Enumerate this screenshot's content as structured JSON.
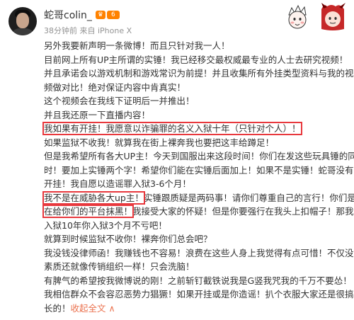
{
  "author": {
    "name": "蛇哥colin_",
    "level_badge": "6"
  },
  "meta": {
    "time": "38分钟前",
    "source": "来自 iPhone X"
  },
  "lines": [
    [
      "另外我要新声明一条微博！而且只针对我一人！"
    ],
    [
      "目前网上所有UP主所谓的实锤！我已经移交最权威最专业的人士去研究视频！"
    ],
    [
      "并且承诺会以游戏机制和游戏常识为前提！并且收集所有外挂类型资料与我的视"
    ],
    [
      "频做对比！绝对保证内容中肯真实！"
    ],
    [
      "这个视频会在我线下证明后一并推出！"
    ],
    [
      "并且我还原一下直播内容！"
    ],
    [
      "我如果有开挂！我愿意以诈骗罪的名义入狱十年（只针对个人）！"
    ],
    [
      "如果监狱不收我！就算我在街上裸奔我也要把这丰给蹲足！"
    ],
    [
      "但是我希望所有各大UP主！今天到国服出来这段时间！你们在发这些玩具锤的同"
    ],
    [
      "时！要加上实锤两个字！希望你们能在实锤后面加上！如果不是实锤！蛇哥没有"
    ],
    [
      "开挂！我自愿以造谣罪入狱3-6个月！"
    ],
    [
      "我不是在威胁各大up主！",
      "实锤跟质疑是两码事！请你们尊重自己的言行！你们是"
    ],
    [
      "在给你们的平台抹黑！",
      "我接受大家的怀疑！但是你要强行在我头上扣帽子！那我"
    ],
    [
      "入狱10年你入狱3个月不亏吧！"
    ],
    [
      "就算到时候监狱不收你！裸奔你们总会吧？"
    ],
    [
      "我没钱没律师函！我赚钱也不容易！浪费在这些人身上我觉得有点可惜！不仅没"
    ],
    [
      "素质还就像传销组织一样！只会洗脑！"
    ],
    [
      "有脾气的希望按我微博说的刚！之前斩钉截铁说我是G竖我咒我的千万不要怂！"
    ],
    [
      "我相信群众不会容忍恶势力猖獗！如果开挂或是你造谣！扒个衣服大家还是很搞"
    ],
    [
      "长的！",
      "收起全文 ∧"
    ]
  ],
  "icons": {
    "vip": "vip-badge-icon",
    "level": "level-badge-icon",
    "avatar": "user-avatar",
    "card_decoration": "cartoon-card-decoration"
  },
  "colors": {
    "highlight_box": "#e8383d",
    "link": "#eb7350",
    "badge": "#ff8200",
    "meta_text": "#939393"
  }
}
